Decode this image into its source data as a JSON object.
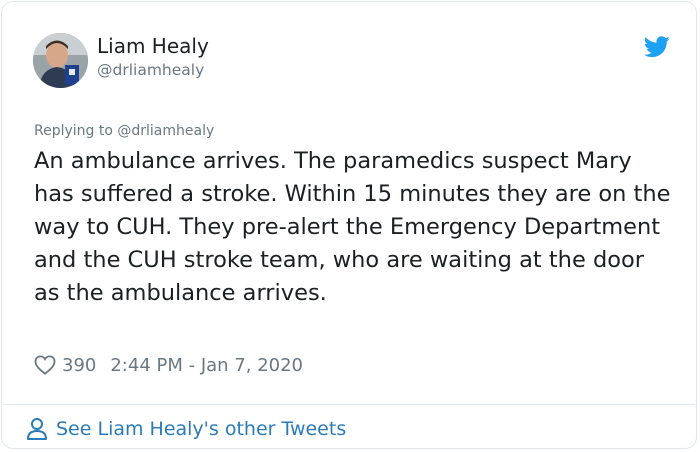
{
  "author": {
    "name": "Liam Healy",
    "handle": "@drliamhealy"
  },
  "tweet": {
    "replying_to": "Replying to @drliamhealy",
    "text": "An ambulance arrives. The paramedics suspect Mary has suffered a stroke. Within 15 minutes they are on the way to CUH. They pre-alert the Emergency Department and the CUH stroke team, who are waiting at the door as the ambulance arrives.",
    "likes": "390",
    "timestamp": "2:44 PM - Jan 7, 2020"
  },
  "footer": {
    "see_more_label": "See Liam Healy's other Tweets"
  },
  "icons": {
    "brand": "twitter-bird-icon",
    "like": "heart-icon",
    "profile": "person-icon"
  },
  "colors": {
    "brand_blue": "#1da1f2",
    "link_blue": "#2b7bb9",
    "text_primary": "#1c2022",
    "text_secondary": "#697882",
    "border": "#e1e8ed"
  }
}
